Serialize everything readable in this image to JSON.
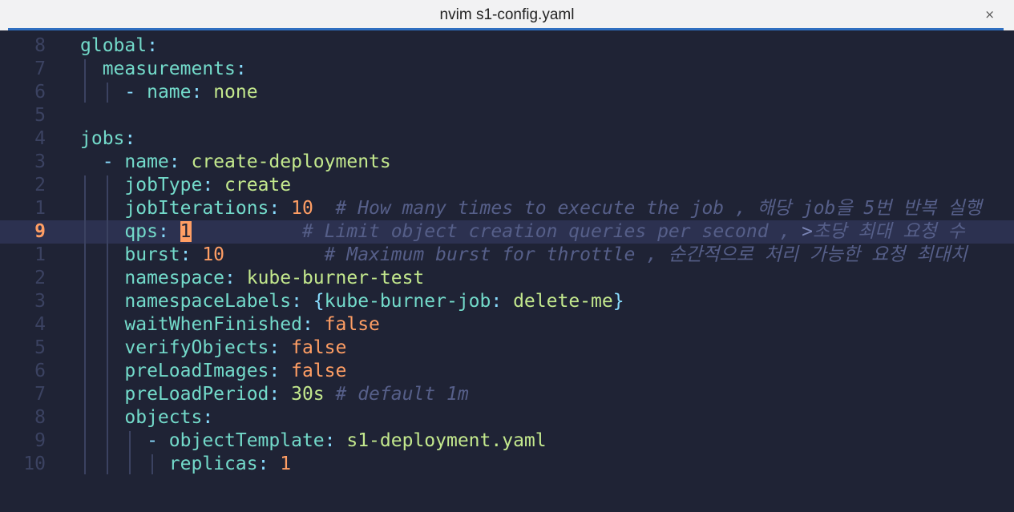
{
  "window": {
    "title": "nvim s1-config.yaml",
    "close_label": "×"
  },
  "editor": {
    "current_line_number": "9",
    "lines": [
      {
        "num": "8",
        "segments": [
          [
            "k",
            "global"
          ],
          [
            "p",
            ":"
          ]
        ]
      },
      {
        "num": "7",
        "segments": [
          [
            "k",
            "  measurements"
          ],
          [
            "p",
            ":"
          ]
        ]
      },
      {
        "num": "6",
        "segments": [
          [
            "p",
            "    - "
          ],
          [
            "k",
            "name"
          ],
          [
            "p",
            ": "
          ],
          [
            "s2",
            "none"
          ]
        ]
      },
      {
        "num": "5",
        "segments": []
      },
      {
        "num": "4",
        "segments": [
          [
            "k",
            "jobs"
          ],
          [
            "p",
            ":"
          ]
        ]
      },
      {
        "num": "3",
        "segments": [
          [
            "p",
            "  - "
          ],
          [
            "k",
            "name"
          ],
          [
            "p",
            ": "
          ],
          [
            "s2",
            "create-deployments"
          ]
        ]
      },
      {
        "num": "2",
        "segments": [
          [
            "k",
            "    jobType"
          ],
          [
            "p",
            ": "
          ],
          [
            "s2",
            "create"
          ]
        ]
      },
      {
        "num": "1",
        "segments": [
          [
            "k",
            "    jobIterations"
          ],
          [
            "p",
            ": "
          ],
          [
            "n",
            "10"
          ],
          [
            "c",
            "  # How many times to execute the job , 해당 job을 5번 반복 실행"
          ]
        ]
      },
      {
        "num": "9",
        "current": true,
        "segments": [
          [
            "k",
            "    qps"
          ],
          [
            "p",
            ": "
          ],
          [
            "cur",
            "1"
          ],
          [
            "c",
            "          # Limit object creation queries per second , "
          ],
          [
            "c2",
            ">"
          ],
          [
            "c",
            "초당 최대 요청 수"
          ]
        ]
      },
      {
        "num": "1",
        "segments": [
          [
            "k",
            "    burst"
          ],
          [
            "p",
            ": "
          ],
          [
            "n",
            "10"
          ],
          [
            "c",
            "         # Maximum burst for throttle , 순간적으로 처리 가능한 요청 최대치"
          ]
        ]
      },
      {
        "num": "2",
        "segments": [
          [
            "k",
            "    namespace"
          ],
          [
            "p",
            ": "
          ],
          [
            "s2",
            "kube-burner-test"
          ]
        ]
      },
      {
        "num": "3",
        "segments": [
          [
            "k",
            "    namespaceLabels"
          ],
          [
            "p",
            ": {"
          ],
          [
            "k",
            "kube-burner-job"
          ],
          [
            "p",
            ": "
          ],
          [
            "s2",
            "delete-me"
          ],
          [
            "p",
            "}"
          ]
        ]
      },
      {
        "num": "4",
        "segments": [
          [
            "k",
            "    waitWhenFinished"
          ],
          [
            "p",
            ": "
          ],
          [
            "b",
            "false"
          ]
        ]
      },
      {
        "num": "5",
        "segments": [
          [
            "k",
            "    verifyObjects"
          ],
          [
            "p",
            ": "
          ],
          [
            "b",
            "false"
          ]
        ]
      },
      {
        "num": "6",
        "segments": [
          [
            "k",
            "    preLoadImages"
          ],
          [
            "p",
            ": "
          ],
          [
            "b",
            "false"
          ]
        ]
      },
      {
        "num": "7",
        "segments": [
          [
            "k",
            "    preLoadPeriod"
          ],
          [
            "p",
            ": "
          ],
          [
            "s2",
            "30s"
          ],
          [
            "c",
            " # default 1m"
          ]
        ]
      },
      {
        "num": "8",
        "segments": [
          [
            "k",
            "    objects"
          ],
          [
            "p",
            ":"
          ]
        ]
      },
      {
        "num": "9",
        "segments": [
          [
            "p",
            "      - "
          ],
          [
            "k",
            "objectTemplate"
          ],
          [
            "p",
            ": "
          ],
          [
            "s2",
            "s1-deployment.yaml"
          ]
        ]
      },
      {
        "num": "10",
        "segments": [
          [
            "k",
            "        replicas"
          ],
          [
            "p",
            ": "
          ],
          [
            "n",
            "1"
          ]
        ]
      }
    ]
  },
  "colors": {
    "background": "#1f2335",
    "keyword": "#73daca",
    "string": "#c3e88d",
    "number": "#ff9e64",
    "comment": "#565f89",
    "line_number": "#3b4261",
    "current_line_number": "#ff9e64",
    "accent_bar": "#2f6fc0"
  }
}
